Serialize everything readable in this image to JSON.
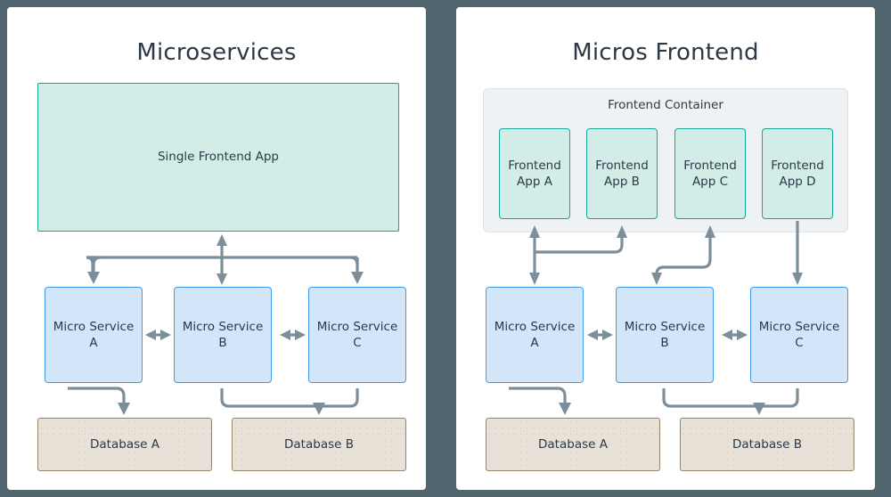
{
  "canvas": {
    "background_color": "#52666f",
    "panel_background": "#ffffff"
  },
  "colors": {
    "frontend_fill": "#d2ece8",
    "frontend_border": "#16a697",
    "service_fill": "#d3e5f8",
    "service_border": "#3f9aea",
    "database_fill": "#e7e1d7",
    "database_border": "#93856b",
    "container_fill": "#eef2f5",
    "arrow": "#7c8e99",
    "text": "#2b3947"
  },
  "left_panel": {
    "title": "Microservices",
    "frontend": {
      "label": "Single Frontend App"
    },
    "services": [
      {
        "line1": "Micro Service",
        "line2": "A"
      },
      {
        "line1": "Micro Service",
        "line2": "B"
      },
      {
        "line1": "Micro Service",
        "line2": "C"
      }
    ],
    "databases": [
      {
        "label": "Database A"
      },
      {
        "label": "Database B"
      }
    ]
  },
  "right_panel": {
    "title": "Micros Frontend",
    "container_label": "Frontend Container",
    "frontend_apps": [
      {
        "line1": "Frontend",
        "line2": "App A"
      },
      {
        "line1": "Frontend",
        "line2": "App B"
      },
      {
        "line1": "Frontend",
        "line2": "App C"
      },
      {
        "line1": "Frontend",
        "line2": "App D"
      }
    ],
    "services": [
      {
        "line1": "Micro Service",
        "line2": "A"
      },
      {
        "line1": "Micro Service",
        "line2": "B"
      },
      {
        "line1": "Micro Service",
        "line2": "C"
      }
    ],
    "databases": [
      {
        "label": "Database A"
      },
      {
        "label": "Database B"
      }
    ]
  }
}
